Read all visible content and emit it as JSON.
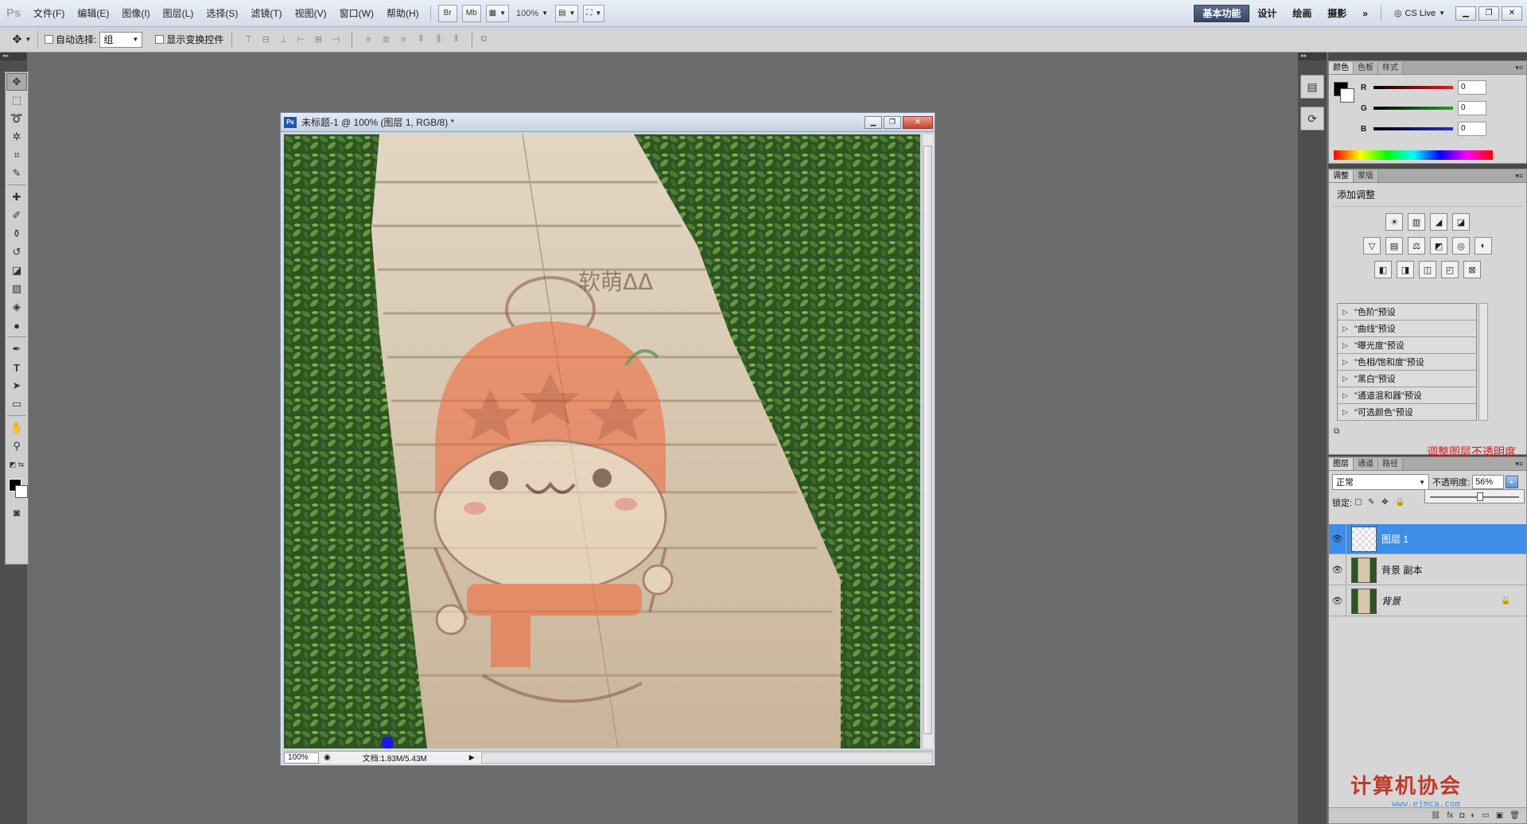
{
  "app": {
    "logo": "Ps",
    "menus": [
      "文件(F)",
      "编辑(E)",
      "图像(I)",
      "图层(L)",
      "选择(S)",
      "滤镜(T)",
      "视图(V)",
      "窗口(W)",
      "帮助(H)"
    ],
    "bridge_btn": "Br",
    "minibridge_btn": "Mb",
    "zoom": "100%",
    "workspaces": [
      "基本功能",
      "设计",
      "绘画",
      "摄影"
    ],
    "more_ws": "»",
    "cs_live": "CS Live"
  },
  "options": {
    "auto_select_label": "自动选择:",
    "auto_select_value": "组",
    "show_transform_label": "显示变换控件"
  },
  "document": {
    "title": "未标题-1 @ 100% (图层 1, RGB/8) *",
    "zoom": "100%",
    "doc_info": "文档:1.83M/5.43M",
    "overlay_text": "软萌ⵠⵠ"
  },
  "color_panel": {
    "tabs": [
      "颜色",
      "色板",
      "样式"
    ],
    "channels": [
      {
        "label": "R",
        "value": "0",
        "color": "#e01f1f"
      },
      {
        "label": "G",
        "value": "0",
        "color": "#1fa51f"
      },
      {
        "label": "B",
        "value": "0",
        "color": "#1f2fd8"
      }
    ]
  },
  "adjust_panel": {
    "tabs": [
      "调整",
      "蒙版"
    ],
    "header": "添加调整",
    "row1": [
      "☀",
      "▥",
      "◢",
      "◪"
    ],
    "row2": [
      "▽",
      "▤",
      "⚖",
      "◩",
      "◎",
      "◐"
    ],
    "row3": [
      "◧",
      "◨",
      "◫",
      "◰",
      "⊠"
    ],
    "presets": [
      "\"色阶\"预设",
      "\"曲线\"预设",
      "\"曝光度\"预设",
      "\"色相/饱和度\"预设",
      "\"黑白\"预设",
      "\"通道混和器\"预设",
      "\"可选颜色\"预设"
    ],
    "red_note": "调整图层不透明度"
  },
  "layers_panel": {
    "tabs": [
      "图层",
      "通道",
      "路径"
    ],
    "blend_mode": "正常",
    "opacity_label": "不透明度:",
    "opacity_value": "56%",
    "opacity_fraction": 0.56,
    "lock_label": "锁定:",
    "layers": [
      {
        "name": "图层 1",
        "selected": true,
        "locked": false
      },
      {
        "name": "背景 副本",
        "selected": false,
        "locked": false
      },
      {
        "name": "背景",
        "selected": false,
        "locked": true
      }
    ]
  },
  "watermark": {
    "text": "计算机协会",
    "url": "www.ejmca.com"
  }
}
